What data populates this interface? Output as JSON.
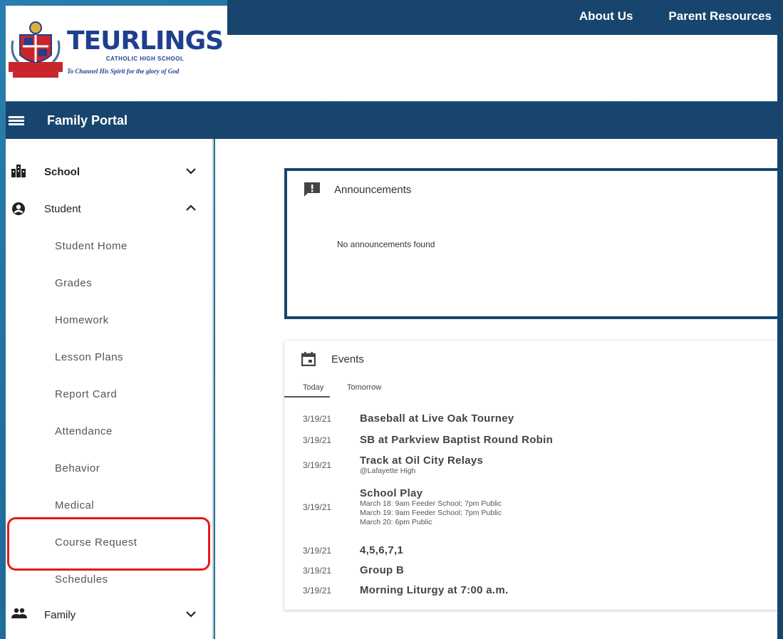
{
  "header": {
    "nav": [
      "About Us",
      "Parent Resources"
    ],
    "logo": {
      "name": "TEURLINGS",
      "subtitle": "CATHOLIC HIGH SCHOOL",
      "motto": "To Channel His Spirit for the glory of God"
    }
  },
  "portal": {
    "title": "Family Portal"
  },
  "sidebar": {
    "sections": [
      {
        "label": "School",
        "icon": "building-icon",
        "expanded": false
      },
      {
        "label": "Student",
        "icon": "account-circle-icon",
        "expanded": true
      },
      {
        "label": "Family",
        "icon": "people-icon",
        "expanded": false
      }
    ],
    "student_items": [
      "Student Home",
      "Grades",
      "Homework",
      "Lesson Plans",
      "Report Card",
      "Attendance",
      "Behavior",
      "Medical",
      "Course Request",
      "Schedules"
    ],
    "highlighted_item": "Course Request"
  },
  "announcements": {
    "title": "Announcements",
    "empty_text": "No announcements found"
  },
  "events": {
    "title": "Events",
    "tabs": [
      "Today",
      "Tomorrow"
    ],
    "active_tab": "Today",
    "items": [
      {
        "date": "3/19/21",
        "title": "Baseball at Live Oak Tourney"
      },
      {
        "date": "3/19/21",
        "title": "SB at Parkview Baptist Round Robin"
      },
      {
        "date": "3/19/21",
        "title": "Track at Oil City Relays",
        "details": [
          "@Lafayette High"
        ]
      },
      {
        "date": "3/19/21",
        "title": "School Play",
        "details": [
          "March 18: 9am Feeder School; 7pm Public",
          "March 19: 9am Feeder School; 7pm Public",
          "March 20: 6pm Public"
        ]
      },
      {
        "date": "3/19/21",
        "title": "4,5,6,7,1"
      },
      {
        "date": "3/19/21",
        "title": "Group B"
      },
      {
        "date": "3/19/21",
        "title": "Morning Liturgy at 7:00 a.m."
      }
    ]
  },
  "colors": {
    "navy": "#17456d",
    "highlight_red": "#e41a1a",
    "logo_blue": "#1f3f8f"
  }
}
